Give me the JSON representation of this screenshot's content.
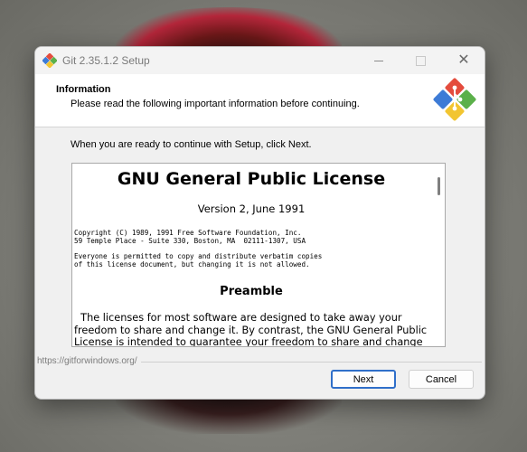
{
  "window": {
    "title": "Git 2.35.1.2 Setup",
    "close_glyph": "✕"
  },
  "header": {
    "title": "Information",
    "subtitle": "Please read the following important information before continuing.",
    "logo_icon": "git-logo-icon"
  },
  "body": {
    "intro": "When you are ready to continue with Setup, click Next."
  },
  "license": {
    "title": "GNU General Public License",
    "version": "Version 2, June 1991",
    "copyright": "Copyright (C) 1989, 1991 Free Software Foundation, Inc.\n59 Temple Place - Suite 330, Boston, MA  02111-1307, USA",
    "permission": "Everyone is permitted to copy and distribute verbatim copies\nof this license document, but changing it is not allowed.",
    "preamble_heading": "Preamble",
    "preamble_text": "  The licenses for most software are designed to take away your\nfreedom to share and change it. By contrast, the GNU General Public\nLicense is intended to guarantee your freedom to share and change"
  },
  "footer": {
    "link": "https://gitforwindows.org/",
    "next_label": "Next",
    "cancel_label": "Cancel"
  },
  "colors": {
    "accent": "#2f6fc9",
    "git_red": "#e44c3d",
    "git_green": "#5bb04a",
    "git_blue": "#3d7bd6",
    "git_yellow": "#f2c531"
  }
}
